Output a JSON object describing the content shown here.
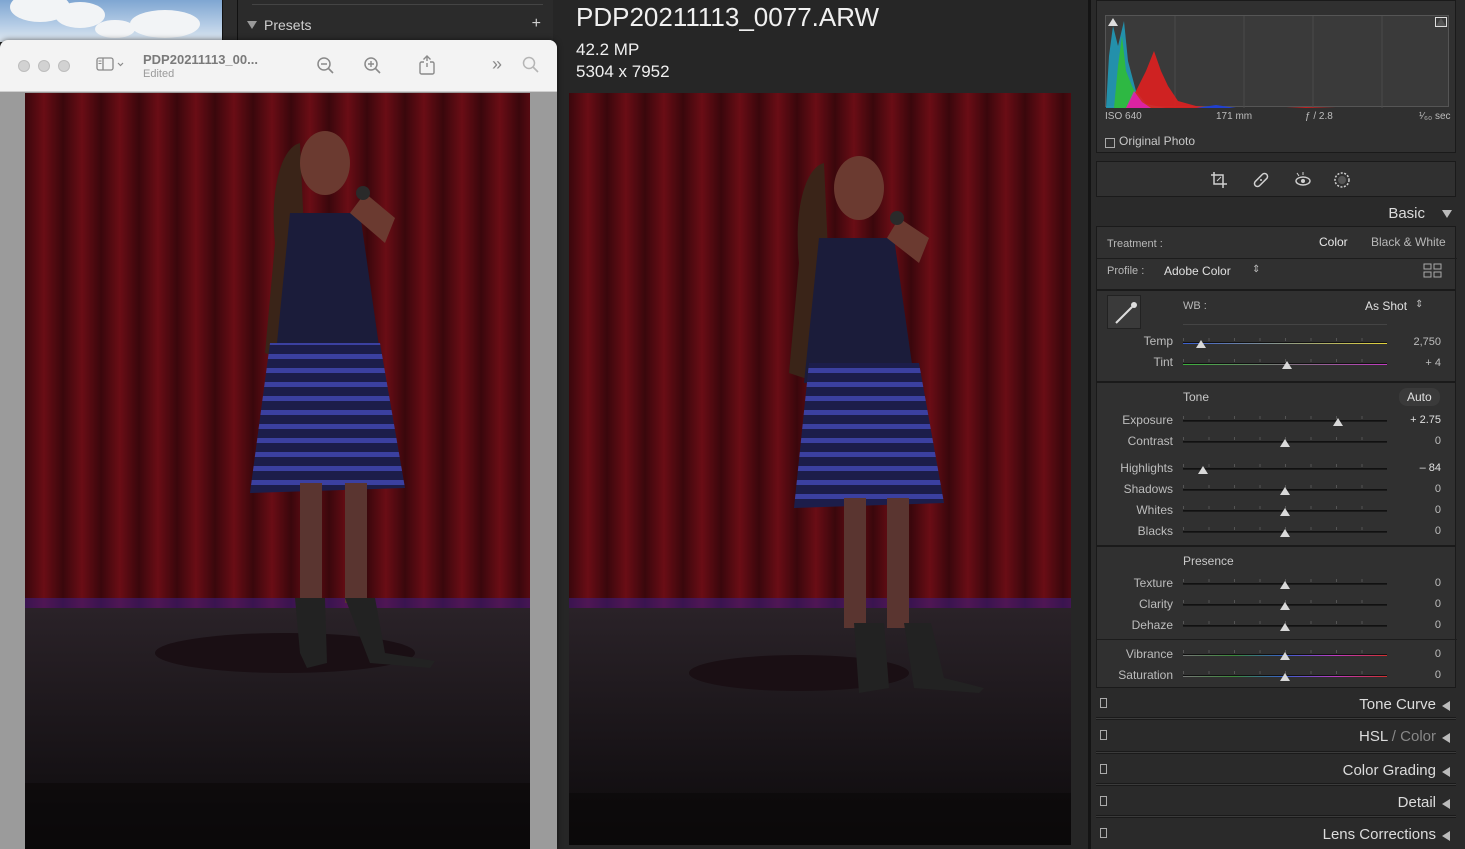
{
  "presets_panel": {
    "label": "Presets",
    "add_symbol": "+"
  },
  "preview_window": {
    "title": "PDP20211113_00...",
    "subtitle": "Edited"
  },
  "photo_info": {
    "filename": "PDP20211113_0077.ARW",
    "megapixels": "42.2 MP",
    "dimensions": "5304 x 7952"
  },
  "histogram": {
    "iso": "ISO 640",
    "focal_length": "171 mm",
    "aperture": "ƒ / 2.8",
    "shutter": "¹⁄₆₀ sec",
    "original_photo_label": "Original Photo"
  },
  "basic": {
    "header": "Basic",
    "treatment_label": "Treatment :",
    "treatment_color": "Color",
    "treatment_bw": "Black & White",
    "profile_label": "Profile :",
    "profile_value": "Adobe Color",
    "wb_label": "WB :",
    "wb_value": "As Shot",
    "temp_label": "Temp",
    "temp_value": "2,750",
    "tint_label": "Tint",
    "tint_value": "+ 4",
    "tone_label": "Tone",
    "auto_label": "Auto",
    "exposure_label": "Exposure",
    "exposure_value": "+ 2.75",
    "contrast_label": "Contrast",
    "contrast_value": "0",
    "highlights_label": "Highlights",
    "highlights_value": "– 84",
    "shadows_label": "Shadows",
    "shadows_value": "0",
    "whites_label": "Whites",
    "whites_value": "0",
    "blacks_label": "Blacks",
    "blacks_value": "0",
    "presence_label": "Presence",
    "texture_label": "Texture",
    "texture_value": "0",
    "clarity_label": "Clarity",
    "clarity_value": "0",
    "dehaze_label": "Dehaze",
    "dehaze_value": "0",
    "vibrance_label": "Vibrance",
    "vibrance_value": "0",
    "saturation_label": "Saturation",
    "saturation_value": "0"
  },
  "sliders": {
    "temp": 0.09,
    "tint": 0.51,
    "exposure": 0.76,
    "contrast": 0.5,
    "highlights": 0.1,
    "shadows": 0.5,
    "whites": 0.5,
    "blacks": 0.5,
    "texture": 0.5,
    "clarity": 0.5,
    "dehaze": 0.5,
    "vibrance": 0.5,
    "saturation": 0.5
  },
  "sections": {
    "tone_curve": "Tone Curve",
    "hsl": "HSL",
    "hsl_sep": " / ",
    "color": "Color",
    "color_grading": "Color Grading",
    "detail": "Detail",
    "lens_corrections": "Lens Corrections"
  },
  "icons": {
    "zoom_out": "zoom-out-icon",
    "zoom_in": "zoom-in-icon",
    "share": "share-icon",
    "more": "chevron-double-right-icon",
    "search": "search-icon",
    "sidebar": "sidebar-icon",
    "crop": "crop-icon",
    "heal": "heal-icon",
    "redeye": "red-eye-icon",
    "mask": "mask-icon",
    "eyedropper": "eyedropper-icon",
    "profile_grid": "grid-icon"
  }
}
